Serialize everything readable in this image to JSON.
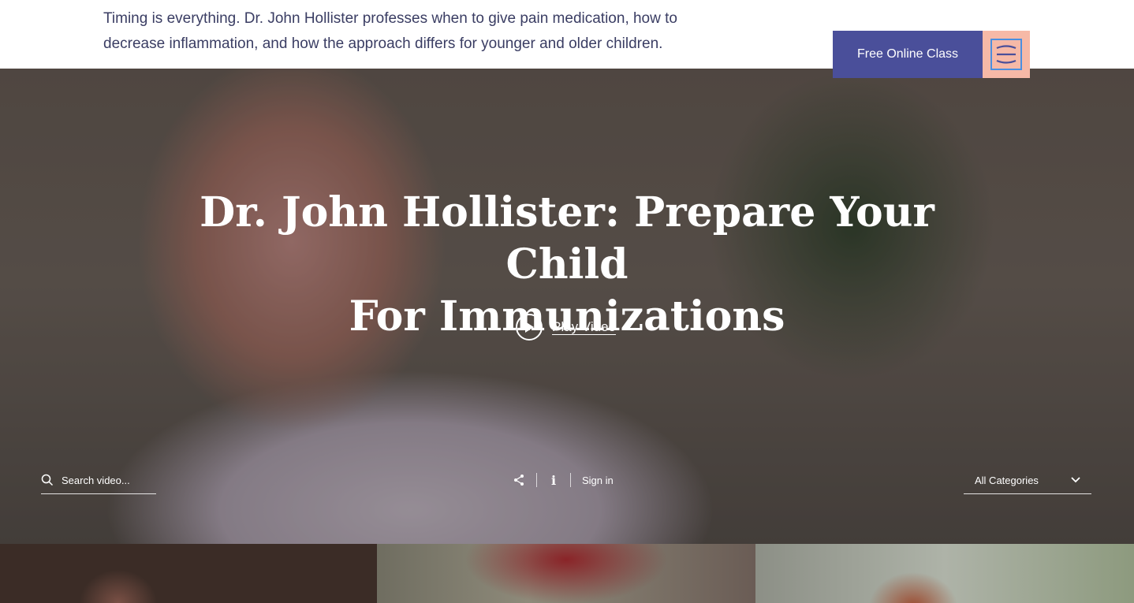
{
  "header": {
    "intro_text": "Timing is everything. Dr. John Hollister professes when to give pain medication, how to decrease inflammation, and how the approach differs for younger and older children.",
    "cta_label": "Free Online Class",
    "menu_icon": "hamburger-menu-icon"
  },
  "hero": {
    "title_line1": "Dr. John Hollister: Prepare Your Child",
    "title_line2": "For Immunizations",
    "play_label": "Play Video",
    "search_placeholder": "Search video...",
    "sign_in_label": "Sign in",
    "category_selected": "All Categories"
  },
  "colors": {
    "cta_bg": "#4a4f9a",
    "menu_bg": "#f6b9a7",
    "intro_text": "#3a3d63"
  }
}
